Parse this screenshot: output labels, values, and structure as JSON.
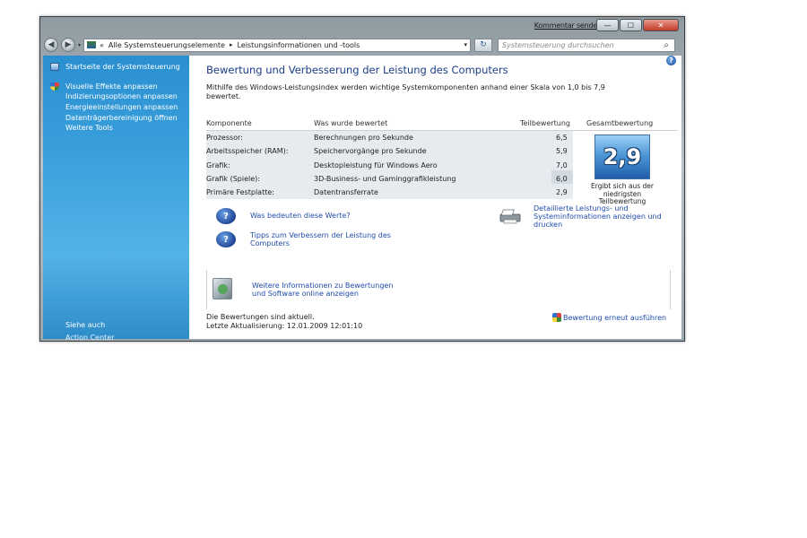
{
  "titlebar": {
    "feedback_link": "Kommentar senden",
    "min_label": "—",
    "max_label": "☐",
    "close_label": "✕"
  },
  "navbar": {
    "back_glyph": "◀",
    "forward_glyph": "▶",
    "dropdown_glyph": "▾",
    "address_prefix": "«",
    "breadcrumb": [
      "Alle Systemsteuerungselemente",
      "Leistungsinformationen und -tools"
    ],
    "breadcrumb_sep": "▸",
    "address_dropdown_glyph": "▾",
    "refresh_glyph": "↻",
    "search_placeholder": "Systemsteuerung durchsuchen",
    "search_glyph": "⌕"
  },
  "sidebar": {
    "home_link": "Startseite der Systemsteuerung",
    "tasks": [
      "Visuelle Effekte anpassen",
      "Indizierungsoptionen anpassen",
      "Energieeinstellungen anpassen",
      "Datenträgerbereinigung öffnen",
      "Weitere Tools"
    ],
    "see_also": "Siehe auch",
    "action_center": "Action Center"
  },
  "main": {
    "help_glyph": "?",
    "title": "Bewertung und Verbesserung der Leistung des Computers",
    "intro": "Mithilfe des Windows-Leistungsindex werden wichtige Systemkomponenten anhand einer Skala von 1,0 bis 7,9 bewertet.",
    "table": {
      "headers": [
        "Komponente",
        "Was wurde bewertet",
        "Teilbewertung",
        "Gesamtbewertung"
      ],
      "rows": [
        {
          "component": "Prozessor:",
          "rated": "Berechnungen pro Sekunde",
          "score": "6,5"
        },
        {
          "component": "Arbeitsspeicher (RAM):",
          "rated": "Speichervorgänge pro Sekunde",
          "score": "5,9"
        },
        {
          "component": "Grafik:",
          "rated": "Desktopleistung für Windows Aero",
          "score": "7,0"
        },
        {
          "component": "Grafik (Spiele):",
          "rated": "3D-Business- und Gaminggrafikleistung",
          "score": "6,0"
        },
        {
          "component": "Primäre Festplatte:",
          "rated": "Datentransferrate",
          "score": "2,9"
        }
      ]
    },
    "base_score": "2,9",
    "base_score_note": "Ergibt sich aus der niedrigsten Teilbewertung",
    "question_glyph": "?",
    "link_meaning": "Was bedeuten diese Werte?",
    "link_tips": "Tipps zum Verbessern der Leistung des Computers",
    "link_print": "Detaillierte Leistungs- und Systeminformationen anzeigen und drucken",
    "link_online": "Weitere Informationen zu Bewertungen und Software online anzeigen",
    "status_current": "Die Bewertungen sind aktuell.",
    "status_last_update": "Letzte Aktualisierung: 12.01.2009 12:01:10",
    "rerun_link": "Bewertung erneut ausführen"
  }
}
